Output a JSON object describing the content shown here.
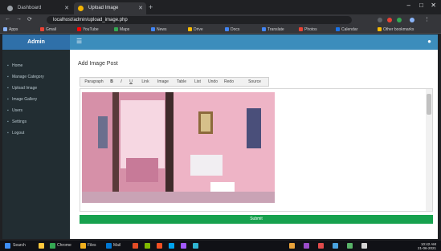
{
  "browser": {
    "tabs": [
      {
        "title": "Dashboard"
      },
      {
        "title": "Upload Image"
      }
    ],
    "new_tab": "+",
    "window_controls": [
      "–",
      "□",
      "✕"
    ],
    "nav": [
      "←",
      "→",
      "⟳"
    ],
    "url": "localhost/admin/upload_image.php",
    "bookmarks": [
      {
        "label": "Apps",
        "color": "#8ab4f8"
      },
      {
        "label": "Gmail",
        "color": "#ea4335"
      },
      {
        "label": "YouTube",
        "color": "#ff0000"
      },
      {
        "label": "Maps",
        "color": "#34a853"
      },
      {
        "label": "News",
        "color": "#4285f4"
      },
      {
        "label": "Drive",
        "color": "#fbbc04"
      },
      {
        "label": "Docs",
        "color": "#4285f4"
      },
      {
        "label": "Translate",
        "color": "#4285f4"
      },
      {
        "label": "Photos",
        "color": "#ea4335"
      },
      {
        "label": "Calendar",
        "color": "#1a73e8"
      },
      {
        "label": "Other bookmarks",
        "color": "#fbbc04"
      }
    ]
  },
  "app": {
    "brand": "Admin",
    "menu_icon": "hamburger-icon",
    "sidebar": [
      {
        "icon": "home-icon",
        "label": "Home"
      },
      {
        "icon": "list-icon",
        "label": "Manage Category"
      },
      {
        "icon": "image-icon",
        "label": "Upload Image"
      },
      {
        "icon": "gallery-icon",
        "label": "Image Gallery"
      },
      {
        "icon": "users-icon",
        "label": "Users"
      },
      {
        "icon": "settings-icon",
        "label": "Settings"
      },
      {
        "icon": "logout-icon",
        "label": "Logout"
      }
    ],
    "page_title": "Add Image Post",
    "toolbar_buttons": [
      "Paragraph",
      "B",
      "I",
      "U",
      "Link",
      "Image",
      "Table",
      "List",
      "Undo",
      "Redo",
      "Source"
    ],
    "submit_label": "Submit"
  },
  "taskbar": {
    "items": [
      {
        "label": "Search",
        "color": "#3d8ef7"
      },
      {
        "label": "",
        "color": "#ffc83d"
      },
      {
        "label": "Chrome",
        "color": "#34a853"
      },
      {
        "label": "Files",
        "color": "#f2b01e"
      },
      {
        "label": "Mail",
        "color": "#0078d4"
      },
      {
        "label": "",
        "color": "#e44d26"
      },
      {
        "label": "",
        "color": "#7fba00"
      },
      {
        "label": "",
        "color": "#f25022"
      },
      {
        "label": "",
        "color": "#00a4ef"
      },
      {
        "label": "",
        "color": "#a259ff"
      },
      {
        "label": "",
        "color": "#2fb5d2"
      }
    ],
    "time": "10:42 AM",
    "date": "21-06-2021"
  }
}
